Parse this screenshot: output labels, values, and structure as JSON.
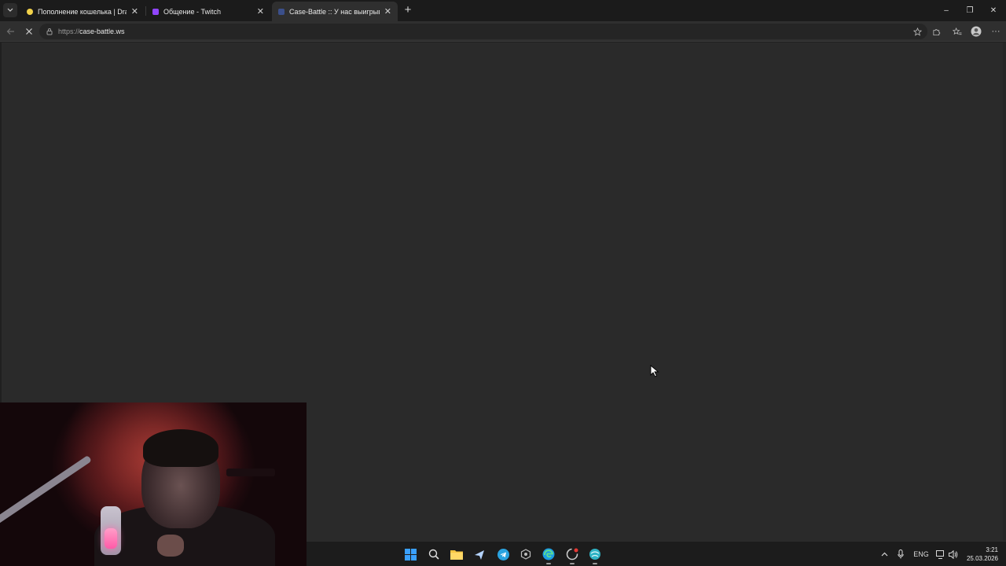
{
  "browser": {
    "tabs": [
      {
        "title": "Пополнение кошелька | Dragon",
        "favicon_color": "#f2d24a",
        "active": false
      },
      {
        "title": "Общение - Twitch",
        "favicon_color": "#9146ff",
        "active": false
      },
      {
        "title": "Case-Battle :: У нас выигрывают",
        "favicon_color": "#3b4f8a",
        "active": true
      }
    ],
    "address": {
      "scheme": "https://",
      "host": "case-battle.ws"
    },
    "window_controls": {
      "minimize": "–",
      "restore": "❐",
      "close": "✕"
    }
  },
  "page": {
    "state": "loading",
    "background": "#2a2a2a"
  },
  "taskbar": {
    "apps": [
      "start-icon",
      "search-icon",
      "file-explorer-icon",
      "steam-icon",
      "telegram-icon",
      "app-icon",
      "edge-icon",
      "browser-icon",
      "app-globe-icon"
    ],
    "tray": {
      "language": "ENG",
      "time": "3:21",
      "date": "25.03.2026"
    }
  },
  "colors": {
    "accent": "#0078d4",
    "tab_active": "#2f2f2f",
    "tabstrip": "#1b1b1b"
  }
}
